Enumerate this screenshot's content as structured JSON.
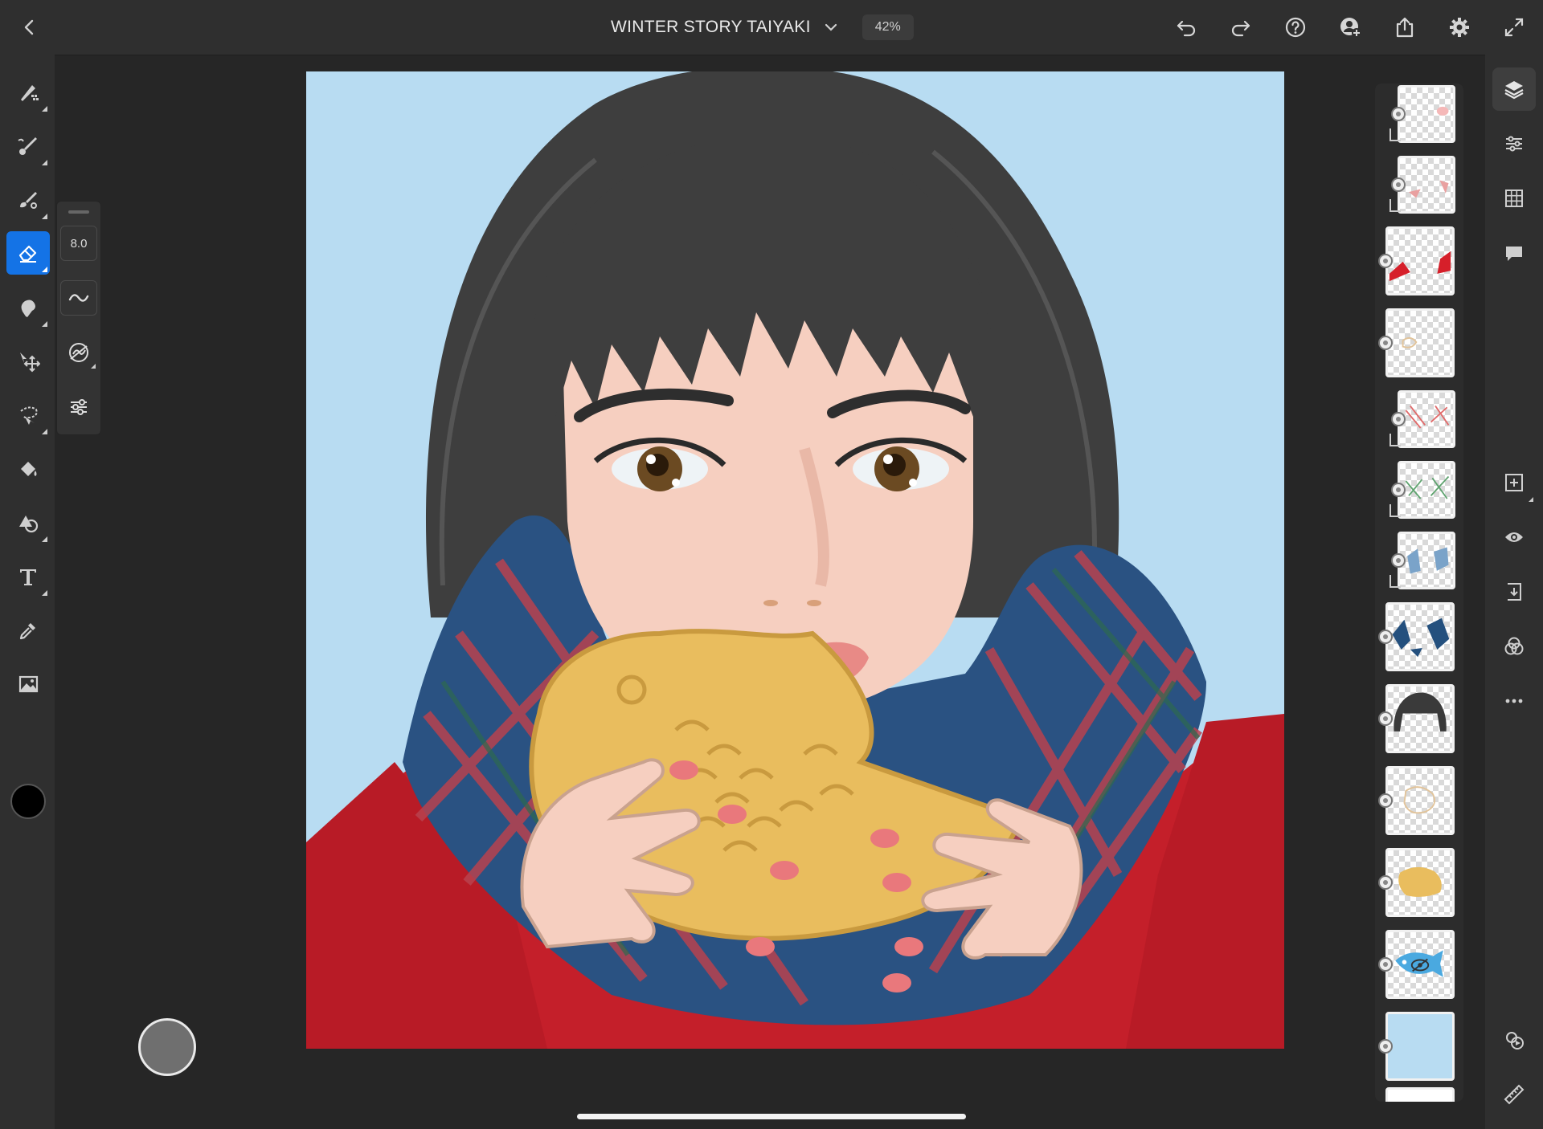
{
  "document": {
    "title": "WINTER STORY TAIYAKI",
    "zoom": "42%"
  },
  "topbar": {
    "icons": [
      "back-icon",
      "chevron-down-icon",
      "undo-icon",
      "redo-icon",
      "help-icon",
      "invite-icon",
      "share-icon",
      "settings-icon",
      "fullscreen-icon"
    ]
  },
  "tools": {
    "items": [
      "pixel-brush",
      "live-brush",
      "vector-brush",
      "eraser",
      "smudge",
      "transform",
      "selection",
      "fill",
      "shapes",
      "type",
      "eyedropper",
      "place-image"
    ],
    "active": "eraser",
    "color": "#000000"
  },
  "brush_flyout": {
    "size": "8.0"
  },
  "layers": {
    "count": 14,
    "hidden_layer": "taiyaki-blue-layer"
  },
  "right_toolbar": {
    "icons": [
      "layers-icon",
      "layer-properties-icon",
      "grid-icon",
      "comments-icon",
      "add-layer-icon",
      "visibility-icon",
      "merge-down-icon",
      "blend-icon",
      "more-icon",
      "timelapse-icon",
      "ruler-icon"
    ]
  },
  "colors": {
    "accent": "#1473e6",
    "canvas_bg": "#b8dcf2",
    "hair": "#3e3e3e",
    "skin": "#f6cfc0",
    "coat": "#c41f2a",
    "taiyaki": "#e9bd5e",
    "scarf": "#2a5282"
  }
}
